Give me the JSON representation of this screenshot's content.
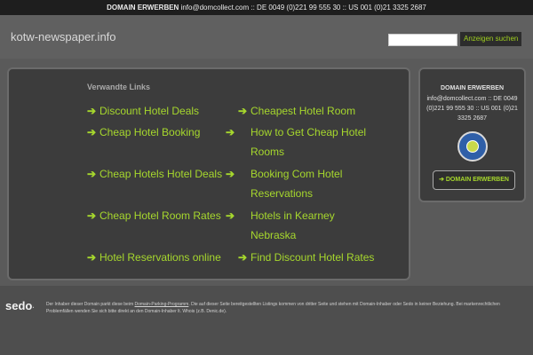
{
  "topbar": {
    "label": "DOMAIN ERWERBEN",
    "contact": "info@domcollect.com :: DE 0049 (0)221 99 555 30 :: US 001 (0)21 3325 2687"
  },
  "header": {
    "site_name": "kotw-newspaper.info",
    "search_placeholder": "",
    "search_button": "Anzeigen suchen"
  },
  "main": {
    "heading": "Verwandte Links",
    "arrow": "➔",
    "links": [
      {
        "label": "Discount Hotel Deals"
      },
      {
        "label": "Cheapest Hotel Room"
      },
      {
        "label": "Cheap Hotel Booking"
      },
      {
        "label": "How to Get Cheap Hotel Rooms"
      },
      {
        "label": "Cheap Hotels Hotel Deals"
      },
      {
        "label": "Booking Com Hotel Reservations"
      },
      {
        "label": "Cheap Hotel Room Rates"
      },
      {
        "label": "Hotels in Kearney Nebraska"
      },
      {
        "label": "Hotel Reservations online"
      },
      {
        "label": "Find Discount Hotel Rates"
      }
    ]
  },
  "sidebar": {
    "title": "DOMAIN ERWERBEN",
    "contact": "info@domcollect.com :: DE 0049 (0)221 99 555 30 :: US 001 (0)21 3325 2687",
    "seal_icon": "trust-seal-icon",
    "button_label": "➔ DOMAIN ERWERBEN"
  },
  "footer": {
    "logo": "sedo",
    "text_before": "Der Inhaber dieser Domain parkt diese beim ",
    "link": "Domain-Parking-Programm",
    "text_after": ". Die auf dieser Seite bereitgestellten Listings kommen von dritter Seite und stehen mit Domain-Inhaber oder Sedo in keiner Beziehung. Bei markenrechtlichen Problemfällen wenden Sie sich bitte direkt an den Domain-Inhaber lt. Whois (z.B. Denic.de)."
  },
  "colors": {
    "accent": "#a6d72d",
    "background": "#5a5a5a",
    "panel": "#3c3c3c"
  }
}
